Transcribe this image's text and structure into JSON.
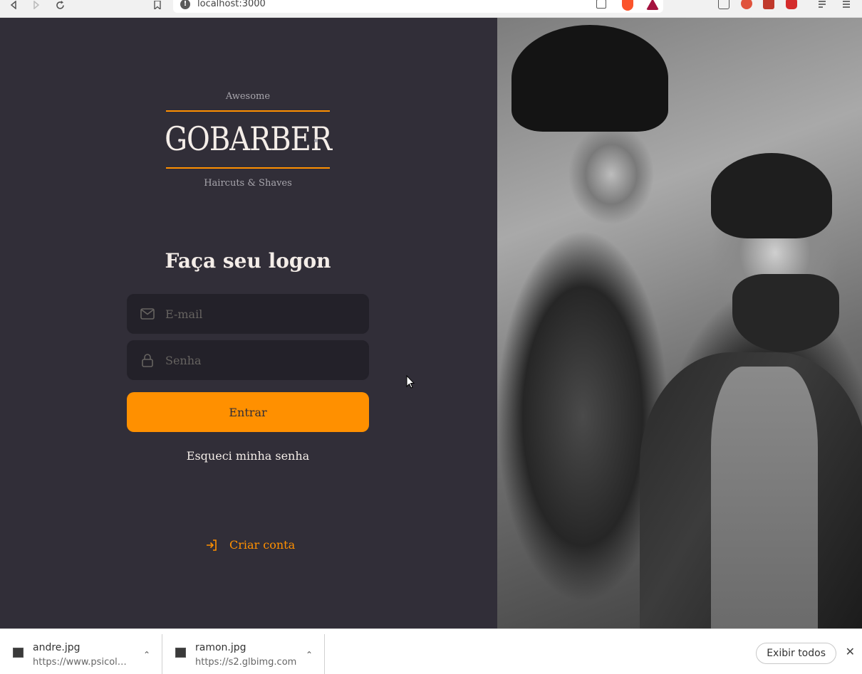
{
  "browser": {
    "url": "localhost:3000",
    "back_icon": "back-arrow-icon",
    "forward_icon": "forward-arrow-icon",
    "reload_icon": "reload-icon",
    "bookmark_icon": "bookmark-icon"
  },
  "logo": {
    "top": "Awesome",
    "name": "GOBARBER",
    "bottom": "Haircuts & Shaves"
  },
  "form": {
    "title": "Faça seu logon",
    "email_placeholder": "E-mail",
    "password_placeholder": "Senha",
    "submit_label": "Entrar",
    "forgot_label": "Esqueci minha senha"
  },
  "create_account": "Criar conta",
  "downloads": [
    {
      "name": "andre.jpg",
      "url": "https://www.psicol…"
    },
    {
      "name": "ramon.jpg",
      "url": "https://s2.glbimg.com"
    }
  ],
  "show_all_label": "Exibir todos",
  "colors": {
    "accent": "#ff9000",
    "background": "#312e38",
    "input_bg": "#232129",
    "text": "#f4ede8",
    "placeholder": "#666360"
  }
}
